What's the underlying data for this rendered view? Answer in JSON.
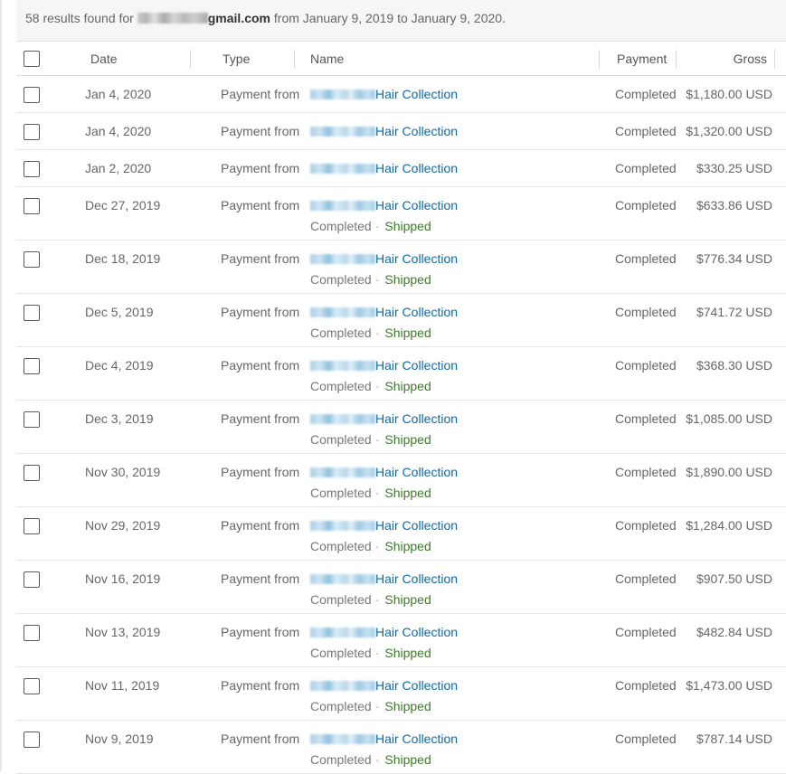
{
  "summary": {
    "count_text": "58 results found for ",
    "email_visible": "gmail.com",
    "range_text": " from January 9, 2019 to January 9, 2020."
  },
  "columns": {
    "date": "Date",
    "type": "Type",
    "name": "Name",
    "payment": "Payment",
    "gross": "Gross"
  },
  "rows": [
    {
      "date": "Jan 4, 2020",
      "type": "Payment from",
      "name": "Hair Collection",
      "payment": "Completed",
      "gross": "$1,180.00 USD",
      "sub_status": "",
      "sub_ship": ""
    },
    {
      "date": "Jan 4, 2020",
      "type": "Payment from",
      "name": "Hair Collection",
      "payment": "Completed",
      "gross": "$1,320.00 USD",
      "sub_status": "",
      "sub_ship": ""
    },
    {
      "date": "Jan 2, 2020",
      "type": "Payment from",
      "name": "Hair Collection",
      "payment": "Completed",
      "gross": "$330.25 USD",
      "sub_status": "",
      "sub_ship": ""
    },
    {
      "date": "Dec 27, 2019",
      "type": "Payment from",
      "name": "Hair Collection",
      "payment": "Completed",
      "gross": "$633.86 USD",
      "sub_status": "Completed",
      "sub_ship": "Shipped"
    },
    {
      "date": "Dec 18, 2019",
      "type": "Payment from",
      "name": "Hair Collection",
      "payment": "Completed",
      "gross": "$776.34 USD",
      "sub_status": "Completed",
      "sub_ship": "Shipped"
    },
    {
      "date": "Dec 5, 2019",
      "type": "Payment from",
      "name": "Hair Collection",
      "payment": "Completed",
      "gross": "$741.72 USD",
      "sub_status": "Completed",
      "sub_ship": "Shipped"
    },
    {
      "date": "Dec 4, 2019",
      "type": "Payment from",
      "name": "Hair Collection",
      "payment": "Completed",
      "gross": "$368.30 USD",
      "sub_status": "Completed",
      "sub_ship": "Shipped"
    },
    {
      "date": "Dec 3, 2019",
      "type": "Payment from",
      "name": "Hair Collection",
      "payment": "Completed",
      "gross": "$1,085.00 USD",
      "sub_status": "Completed",
      "sub_ship": "Shipped"
    },
    {
      "date": "Nov 30, 2019",
      "type": "Payment from",
      "name": "Hair Collection",
      "payment": "Completed",
      "gross": "$1,890.00 USD",
      "sub_status": "Completed",
      "sub_ship": "Shipped"
    },
    {
      "date": "Nov 29, 2019",
      "type": "Payment from",
      "name": "Hair Collection",
      "payment": "Completed",
      "gross": "$1,284.00 USD",
      "sub_status": "Completed",
      "sub_ship": "Shipped"
    },
    {
      "date": "Nov 16, 2019",
      "type": "Payment from",
      "name": "Hair Collection",
      "payment": "Completed",
      "gross": "$907.50 USD",
      "sub_status": "Completed",
      "sub_ship": "Shipped"
    },
    {
      "date": "Nov 13, 2019",
      "type": "Payment from",
      "name": "Hair Collection",
      "payment": "Completed",
      "gross": "$482.84 USD",
      "sub_status": "Completed",
      "sub_ship": "Shipped"
    },
    {
      "date": "Nov 11, 2019",
      "type": "Payment from",
      "name": "Hair Collection",
      "payment": "Completed",
      "gross": "$1,473.00 USD",
      "sub_status": "Completed",
      "sub_ship": "Shipped"
    },
    {
      "date": "Nov 9, 2019",
      "type": "Payment from",
      "name": "Hair Collection",
      "payment": "Completed",
      "gross": "$787.14 USD",
      "sub_status": "Completed",
      "sub_ship": "Shipped"
    }
  ],
  "colors": {
    "link": "#0f6aa3",
    "shipped": "#3d7a2a",
    "summary_bg": "#f5f6f7"
  }
}
